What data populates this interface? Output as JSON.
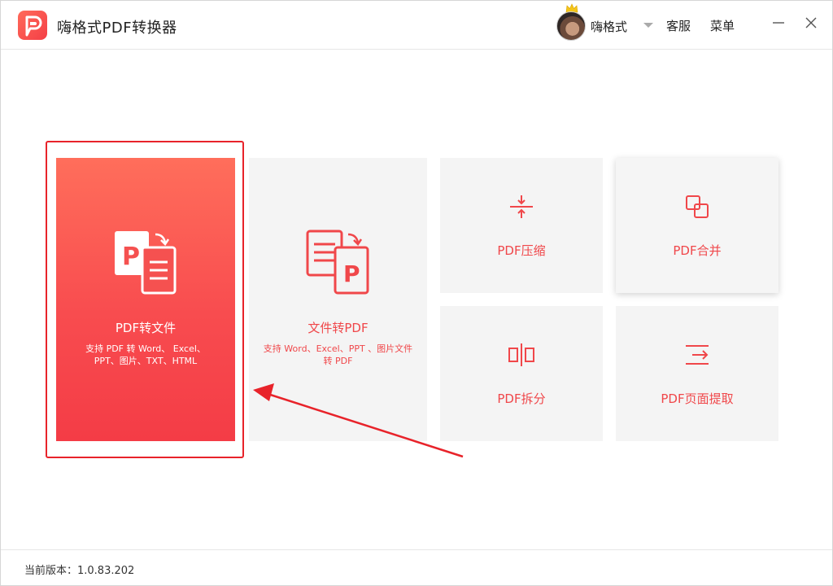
{
  "app": {
    "title": "嗨格式PDF转换器"
  },
  "header": {
    "username": "嗨格式",
    "service_label": "客服",
    "menu_label": "菜单"
  },
  "cards": {
    "pdf_to_file": {
      "label": "PDF转文件",
      "desc": "支持 PDF 转 Word、 Excel、PPT、图片、TXT、HTML"
    },
    "file_to_pdf": {
      "label": "文件转PDF",
      "desc": "支持 Word、Excel、PPT 、图片文件转 PDF"
    },
    "compress": {
      "label": "PDF压缩"
    },
    "merge": {
      "label": "PDF合并"
    },
    "split": {
      "label": "PDF拆分"
    },
    "extract": {
      "label": "PDF页面提取"
    }
  },
  "footer": {
    "version": "当前版本：1.0.83.202"
  },
  "colors": {
    "accent": "#f0474a",
    "highlight": "#e8232a",
    "card_bg": "#f4f4f4"
  }
}
